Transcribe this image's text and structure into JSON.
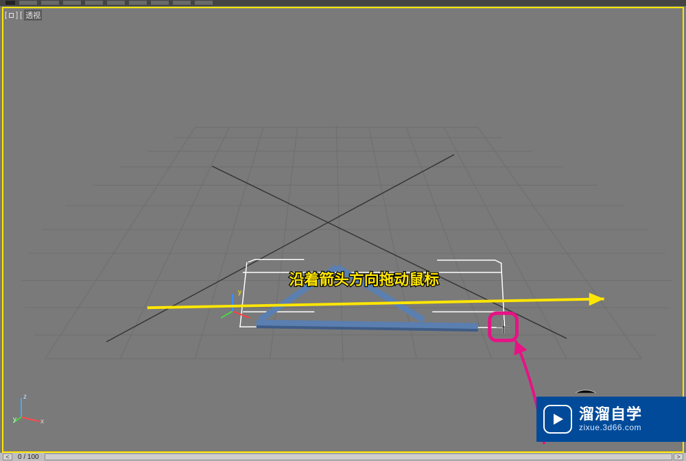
{
  "viewport": {
    "label": "透视"
  },
  "annotation_text": "沿着箭头方向拖动鼠标",
  "axis_labels": {
    "x": "x",
    "y": "y",
    "z": "z"
  },
  "timeline": {
    "prev": "<",
    "frame": "0 / 100",
    "next": ">"
  },
  "watermark": {
    "title": "溜溜自学",
    "sub": "zixue.3d66.com"
  },
  "icons": {
    "cursor": "crosshair-cursor"
  }
}
